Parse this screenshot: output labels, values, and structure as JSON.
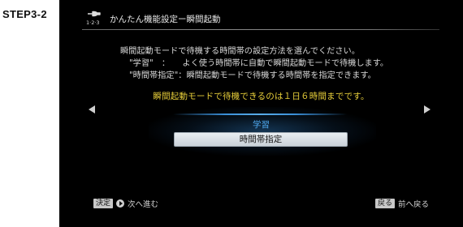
{
  "step_label": "STEP3-2",
  "header": {
    "icon_label": "1·2·3",
    "title": "かんたん機能設定ー瞬間起動"
  },
  "description": {
    "line1": "瞬間起動モードで待機する時間帯の設定方法を選んでください。",
    "line2": "\"学習\"　：　　よく使う時間帯に自動で瞬間起動モードで待機します。",
    "line3": "\"時間帯指定\"：瞬間起動モードで待機する時間帯を指定できます。"
  },
  "notice": "瞬間起動モードで待機できるのは１日６時間までです。",
  "menu": {
    "items": [
      {
        "label": "学習",
        "state": "normal"
      },
      {
        "label": "時間帯指定",
        "state": "selected"
      }
    ]
  },
  "footer": {
    "left_key": "決定",
    "left_text": "次へ進む",
    "right_key": "戻る",
    "right_text": "前へ戻る"
  },
  "colors": {
    "background": "#000000",
    "notice": "#e8cf3a",
    "menu_item": "#4fa8ee",
    "selection": "#dfe5ea"
  }
}
